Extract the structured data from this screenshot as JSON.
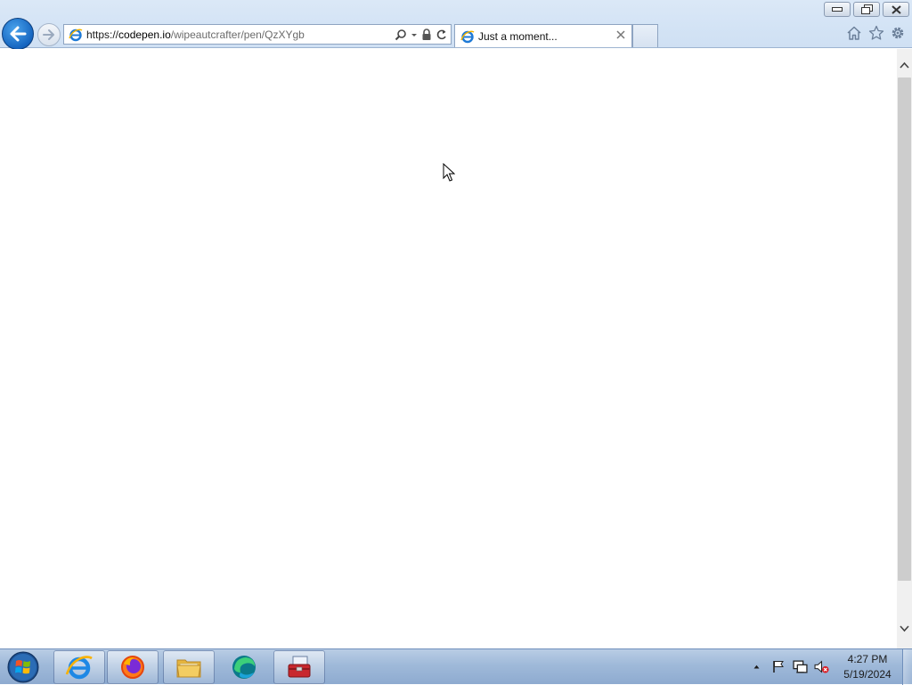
{
  "window": {
    "minimize_label": "Minimize",
    "restore_label": "Restore Down",
    "close_label": "Close"
  },
  "nav": {
    "back_icon": "back-arrow-icon",
    "forward_icon": "forward-arrow-icon"
  },
  "address_bar": {
    "scheme": "https://",
    "host": "codepen.io",
    "path": "/wipeautcrafter/pen/QzXYgb",
    "icons": [
      "search-icon",
      "dropdown-icon",
      "lock-icon",
      "refresh-icon"
    ]
  },
  "tab": {
    "title": "Just a moment..."
  },
  "toolbar_icons": [
    "home-icon",
    "favorites-star-icon",
    "settings-gear-icon"
  ],
  "taskbar": {
    "pinned": [
      "internet-explorer",
      "firefox",
      "file-explorer",
      "edge",
      "toolbox"
    ],
    "clock": {
      "time": "4:27 PM",
      "date": "5/19/2024"
    }
  }
}
